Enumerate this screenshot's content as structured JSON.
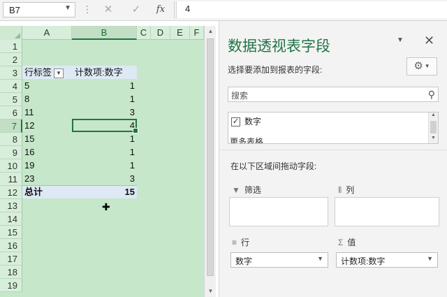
{
  "formula_bar": {
    "name_box": "B7",
    "separator": "⋮",
    "cancel_glyph": "✕",
    "enter_glyph": "✓",
    "fx_glyph": "fx",
    "value": "4"
  },
  "sheet": {
    "columns": [
      "A",
      "B",
      "C",
      "D",
      "E",
      "F"
    ],
    "selected_column": "B",
    "rows": [
      "1",
      "2",
      "3",
      "4",
      "5",
      "6",
      "7",
      "8",
      "9",
      "10",
      "11",
      "12",
      "13",
      "14",
      "15",
      "16",
      "17",
      "18",
      "19"
    ],
    "selected_row": "7",
    "pivot_header": {
      "row_label": "行标签",
      "value_label": "计数项:数字"
    },
    "pivot_rows": [
      {
        "label": "5",
        "count": "1"
      },
      {
        "label": "8",
        "count": "1"
      },
      {
        "label": "11",
        "count": "3"
      },
      {
        "label": "12",
        "count": "4"
      },
      {
        "label": "15",
        "count": "1"
      },
      {
        "label": "16",
        "count": "1"
      },
      {
        "label": "19",
        "count": "1"
      },
      {
        "label": "23",
        "count": "3"
      }
    ],
    "total": {
      "label": "总计",
      "count": "15"
    }
  },
  "pivot_pane": {
    "title": "数据透视表字段",
    "choose_fields_label": "选择要添加到报表的字段:",
    "search_placeholder": "搜索",
    "field_name": "数字",
    "more_tables": "更多表格...",
    "drag_label": "在以下区域间拖动字段:",
    "areas": {
      "filter": "筛选",
      "columns": "列",
      "rows": "行",
      "values": "值"
    },
    "row_field": "数字",
    "value_field": "计数项:数字"
  },
  "colors": {
    "accent": "#217346",
    "sheet_bg": "#c6e7c9",
    "pivot_band": "#dde9f4"
  }
}
